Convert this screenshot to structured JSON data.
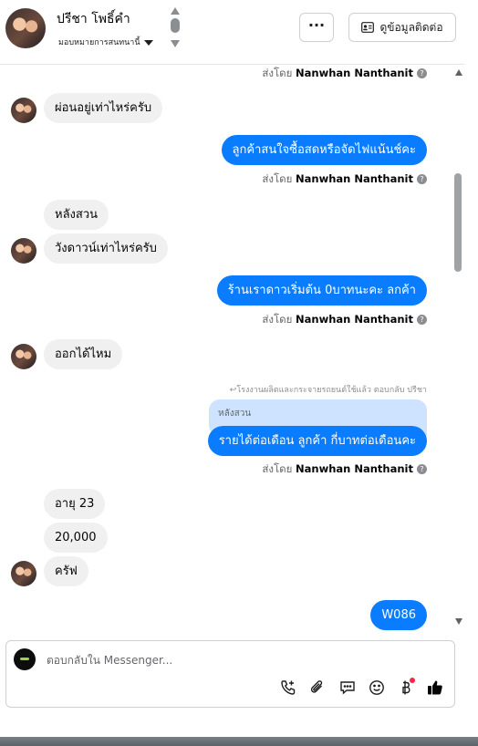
{
  "header": {
    "contact_name": "ปรีชา โพธิ์คำ",
    "assignment": "มอบหมายการสนทนานี้",
    "more_label": "···",
    "contact_info_label": "ดูข้อมูลติดต่อ"
  },
  "thread": {
    "messages": [
      {
        "kind": "sent_by",
        "prefix": "ส่งโดย",
        "name": "Nanwhan Nanthanit"
      },
      {
        "kind": "in",
        "text": "ผ่อนอยู่เท่าไหร่ครับ"
      },
      {
        "kind": "out",
        "text": "ลูกค้าสนใจซื้อสดหรือจัดไฟแน้นช์คะ"
      },
      {
        "kind": "sent_by",
        "prefix": "ส่งโดย",
        "name": "Nanwhan Nanthanit"
      },
      {
        "kind": "in",
        "text": "หลังสวน"
      },
      {
        "kind": "in",
        "text": "วังดาวน์เท่าไหร่ครับ"
      },
      {
        "kind": "out",
        "text": "ร้านเราดาวเริ่มต้น  0บาทนะคะ  ลกค้า"
      },
      {
        "kind": "sent_by",
        "prefix": "ส่งโดย",
        "name": "Nanwhan Nanthanit"
      },
      {
        "kind": "in",
        "text": "ออกได้ไหม"
      },
      {
        "kind": "reply_note",
        "text": "โรงงานผลิตและกระจายรถยนต์ใช้แล้ว ตอบกลับ ปรีชา"
      },
      {
        "kind": "quoted",
        "text": "หลังสวน"
      },
      {
        "kind": "out",
        "text": "รายได้ต่อเดือน  ลูกค้า  กี่บาทต่อเดือนคะ"
      },
      {
        "kind": "sent_by",
        "prefix": "ส่งโดย",
        "name": "Nanwhan Nanthanit"
      },
      {
        "kind": "in",
        "text": "อายุ 23"
      },
      {
        "kind": "in",
        "text": "20,000"
      },
      {
        "kind": "in",
        "text": "ครัฟ"
      },
      {
        "kind": "out",
        "text": "W086"
      }
    ]
  },
  "composer": {
    "placeholder": "ตอบกลับใน Messenger..."
  },
  "icons": {
    "call": "phone-add-icon",
    "attach": "paperclip-icon",
    "saved_reply": "chat-bubble-icon",
    "emoji": "smiley-icon",
    "payment": "baht-icon",
    "like": "thumbs-up-icon"
  },
  "colors": {
    "outgoing_bubble": "#0a7cff",
    "incoming_bubble": "#f0f0f0",
    "quoted_bubble": "#cde3ff",
    "like": "#050505",
    "notification_dot": "#f02849"
  }
}
